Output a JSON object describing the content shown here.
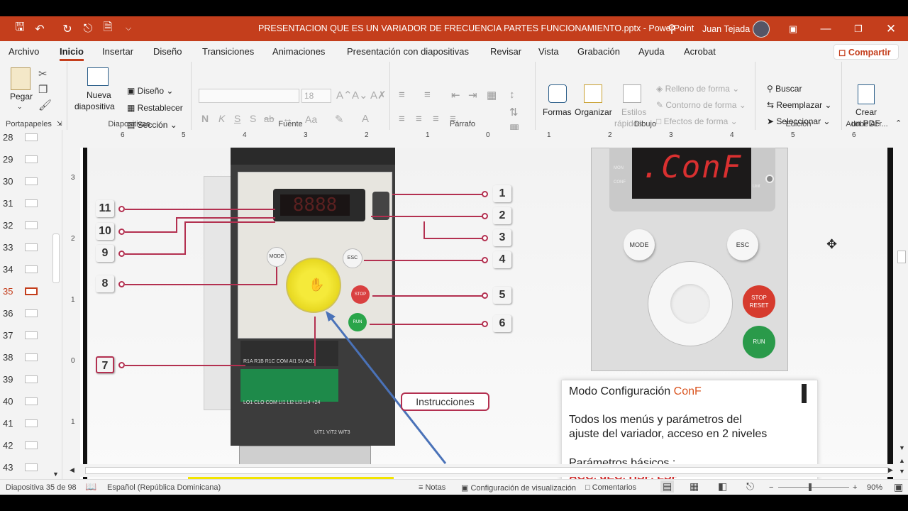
{
  "window": {
    "doc_title": "PRESENTACION QUE ES UN VARIADOR DE FRECUENCIA PARTES FUNCIONAMIENTO.pptx",
    "app_name": "PowerPoint",
    "separator": "-",
    "user_name": "Juan Tejada"
  },
  "menu": {
    "tabs": [
      "Archivo",
      "Inicio",
      "Insertar",
      "Diseño",
      "Transiciones",
      "Animaciones",
      "Presentación con diapositivas",
      "Revisar",
      "Vista",
      "Grabación",
      "Ayuda",
      "Acrobat"
    ],
    "active": "Inicio",
    "share": "Compartir"
  },
  "ribbon": {
    "clipboard": {
      "paste": "Pegar",
      "label": "Portapapeles"
    },
    "slides": {
      "new_slide_1": "Nueva",
      "new_slide_2": "diapositiva",
      "layout": "Diseño",
      "reset": "Restablecer",
      "section": "Sección",
      "label": "Diapositivas"
    },
    "font": {
      "size": "18",
      "bold": "N",
      "italic": "K",
      "underline": "S",
      "shadow": "S",
      "strike": "ab",
      "case": "Aa",
      "label": "Fuente"
    },
    "paragraph": {
      "label": "Párrafo"
    },
    "drawing": {
      "shapes": "Formas",
      "arrange": "Organizar",
      "styles_1": "Estilos",
      "styles_2": "rápidos",
      "fill": "Relleno de forma",
      "outline": "Contorno de forma",
      "effects": "Efectos de forma",
      "label": "Dibujo"
    },
    "editing": {
      "find": "Buscar",
      "replace": "Reemplazar",
      "select": "Seleccionar",
      "label": "Edición"
    },
    "adobe": {
      "create_1": "Crear",
      "create_2": "un PDF",
      "label": "Adobe Acr..."
    }
  },
  "ruler": [
    "6",
    "5",
    "4",
    "3",
    "2",
    "1",
    "0",
    "1",
    "2",
    "3",
    "4",
    "5",
    "6"
  ],
  "vruler": [
    "3",
    "2",
    "1",
    "0",
    "1"
  ],
  "slides": [
    {
      "n": "28"
    },
    {
      "n": "29"
    },
    {
      "n": "30"
    },
    {
      "n": "31"
    },
    {
      "n": "32"
    },
    {
      "n": "33"
    },
    {
      "n": "34"
    },
    {
      "n": "35",
      "current": true
    },
    {
      "n": "36"
    },
    {
      "n": "37"
    },
    {
      "n": "38"
    },
    {
      "n": "39"
    },
    {
      "n": "40"
    },
    {
      "n": "41"
    },
    {
      "n": "42"
    },
    {
      "n": "43"
    }
  ],
  "slide": {
    "left_callouts": [
      "11",
      "10",
      "9",
      "8",
      "7"
    ],
    "right_callouts": [
      "1",
      "2",
      "3",
      "4",
      "5",
      "6"
    ],
    "instructions": "Instrucciones",
    "display": ".ConF",
    "panel": {
      "mode": "MODE",
      "esc": "ESC",
      "stop": "STOP",
      "reset": "RESET",
      "run": "RUN",
      "mon": "MON",
      "conf": "CONF",
      "unit": "Unit"
    },
    "small": {
      "mode": "MODE",
      "esc": "ESC",
      "stop": "STOP",
      "run": "RUN"
    },
    "terminals_top": "R1A R1B R1C  COM  AI1 5V  AO1",
    "terminals_bottom": "LO1 CLO COM LI1  LI2  LI3  LI4 +24",
    "motor": "U/T1  V/T2  W/T3",
    "box": {
      "title_pre": "Modo Configuración ",
      "title_accent": "ConF",
      "line1": "Todos los menús y parámetros del",
      "line2": "ajuste del variador, acceso en 2 niveles",
      "line3": "Parámetros básicos :",
      "line4": "ACC, dEC, HSP, LSP"
    }
  },
  "status": {
    "slide_info": "Diapositiva 35 de 98",
    "language": "Español (República Dominicana)",
    "notes": "Notas",
    "display_settings": "Configuración de visualización",
    "comments": "Comentarios",
    "minus": "−",
    "plus": "+",
    "zoom": "90%"
  },
  "colors": {
    "accent": "#c43e1c",
    "callout": "#b33050",
    "arrow": "#4a72b8",
    "knob": "#f0e31e",
    "display": "#d93030"
  }
}
